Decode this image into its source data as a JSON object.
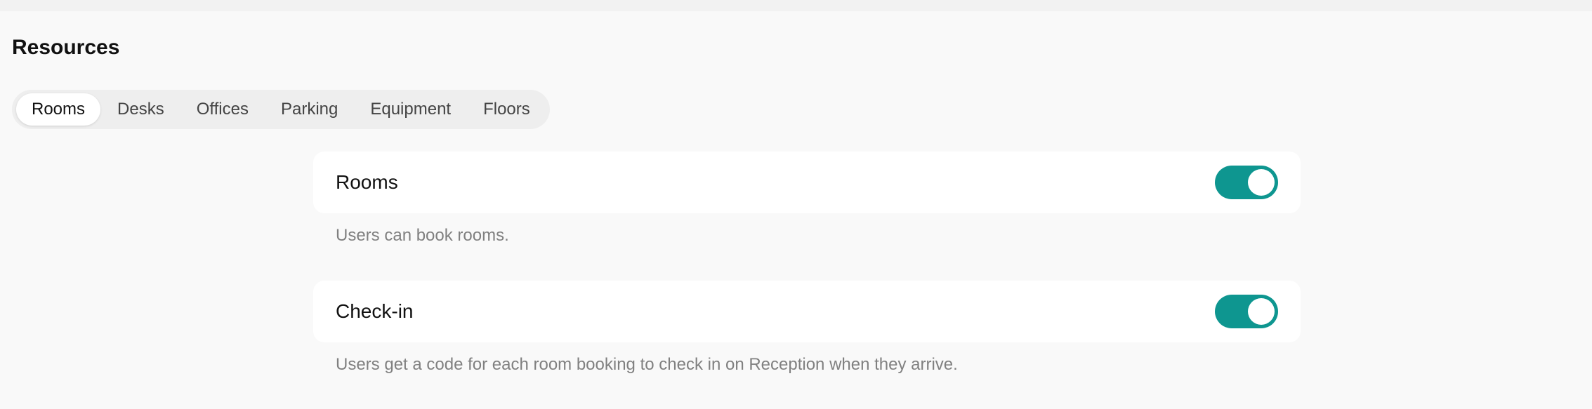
{
  "header": {
    "title": "Resources"
  },
  "tabs": [
    {
      "label": "Rooms",
      "active": true
    },
    {
      "label": "Desks",
      "active": false
    },
    {
      "label": "Offices",
      "active": false
    },
    {
      "label": "Parking",
      "active": false
    },
    {
      "label": "Equipment",
      "active": false
    },
    {
      "label": "Floors",
      "active": false
    }
  ],
  "settings": [
    {
      "label": "Rooms",
      "description": "Users can book rooms.",
      "enabled": true
    },
    {
      "label": "Check-in",
      "description": "Users get a code for each room booking to check in on Reception when they arrive.",
      "enabled": true
    }
  ],
  "colors": {
    "accent": "#0e9690",
    "background": "#f9f9f9",
    "card": "#ffffff",
    "muted_text": "#808080"
  }
}
